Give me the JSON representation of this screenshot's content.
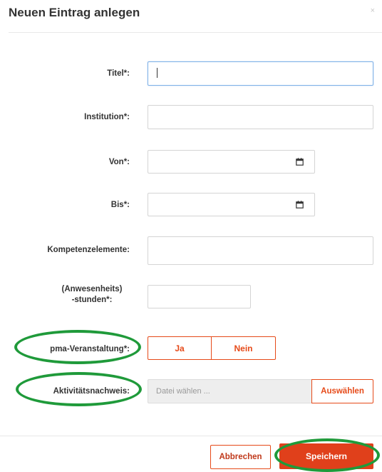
{
  "dialog": {
    "title": "Neuen Eintrag anlegen",
    "close_symbol": "×"
  },
  "form": {
    "titel_label": "Titel*:",
    "institution_label": "Institution*:",
    "von_label": "Von*:",
    "bis_label": "Bis*:",
    "kompetenz_label": "Kompetenzelemente:",
    "stunden_label_line1": "(Anwesenheits)",
    "stunden_label_line2": "-stunden*:",
    "pma_label": "pma-Veranstaltung*:",
    "pma_options": [
      "Ja",
      "Nein"
    ],
    "nachweis_label": "Aktivitätsnachweis:",
    "file_placeholder": "Datei wählen ...",
    "file_button": "Auswählen"
  },
  "footer": {
    "cancel_label": "Abbrechen",
    "save_label": "Speichern"
  },
  "colors": {
    "accent": "#e64a19",
    "highlight_ellipse": "#1f9a3a"
  },
  "icons": [
    "calendar-icon",
    "close-icon"
  ]
}
